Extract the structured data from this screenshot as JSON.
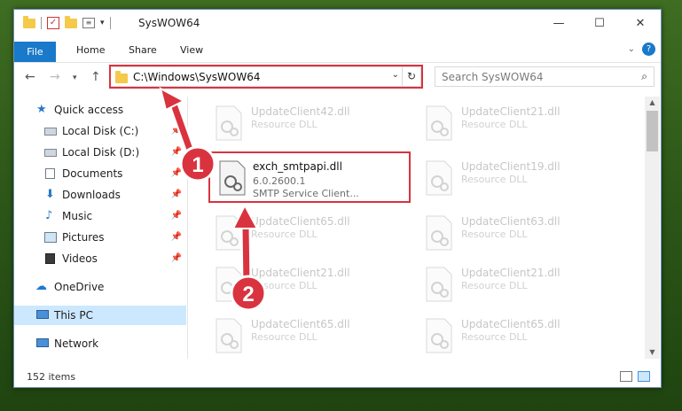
{
  "window": {
    "title": "SysWOW64"
  },
  "ribbon": {
    "tabs": [
      "File",
      "Home",
      "Share",
      "View"
    ]
  },
  "address": {
    "path": "C:\\Windows\\SysWOW64"
  },
  "search": {
    "placeholder": "Search SysWOW64"
  },
  "nav": {
    "items": [
      {
        "label": "Quick access"
      },
      {
        "label": "Local Disk (C:)"
      },
      {
        "label": "Local Disk (D:)"
      },
      {
        "label": "Documents"
      },
      {
        "label": "Downloads"
      },
      {
        "label": "Music"
      },
      {
        "label": "Pictures"
      },
      {
        "label": "Videos"
      },
      {
        "label": "OneDrive"
      },
      {
        "label": "This PC"
      },
      {
        "label": "Network"
      }
    ]
  },
  "files": {
    "main": {
      "name": "exch_smtpapi.dll",
      "version": "6.0.2600.1",
      "description": "SMTP Service Client..."
    },
    "left": [
      {
        "name": "UpdateClient42.dll",
        "type": "Resource DLL"
      },
      {
        "name": "UpdateClient65.dll",
        "type": "Resource DLL"
      },
      {
        "name": "UpdateClient21.dll",
        "type": "Resource DLL"
      },
      {
        "name": "UpdateClient65.dll",
        "type": "Resource DLL"
      }
    ],
    "right": [
      {
        "name": "UpdateClient21.dll",
        "type": "Resource DLL"
      },
      {
        "name": "UpdateClient19.dll",
        "type": "Resource DLL"
      },
      {
        "name": "UpdateClient63.dll",
        "type": "Resource DLL"
      },
      {
        "name": "UpdateClient21.dll",
        "type": "Resource DLL"
      },
      {
        "name": "UpdateClient65.dll",
        "type": "Resource DLL"
      }
    ]
  },
  "status": {
    "count": "152 items"
  },
  "annotations": {
    "step1": "1",
    "step2": "2",
    "color": "#d9333f"
  },
  "icons": [
    "folder-icon",
    "check-icon",
    "properties-icon",
    "back-arrow-icon",
    "forward-arrow-icon",
    "up-arrow-icon",
    "refresh-icon",
    "search-icon",
    "star-icon",
    "drive-icon",
    "documents-icon",
    "downloads-icon",
    "music-icon",
    "pictures-icon",
    "videos-icon",
    "onedrive-icon",
    "this-pc-icon",
    "network-icon",
    "dll-file-icon",
    "pin-icon"
  ]
}
